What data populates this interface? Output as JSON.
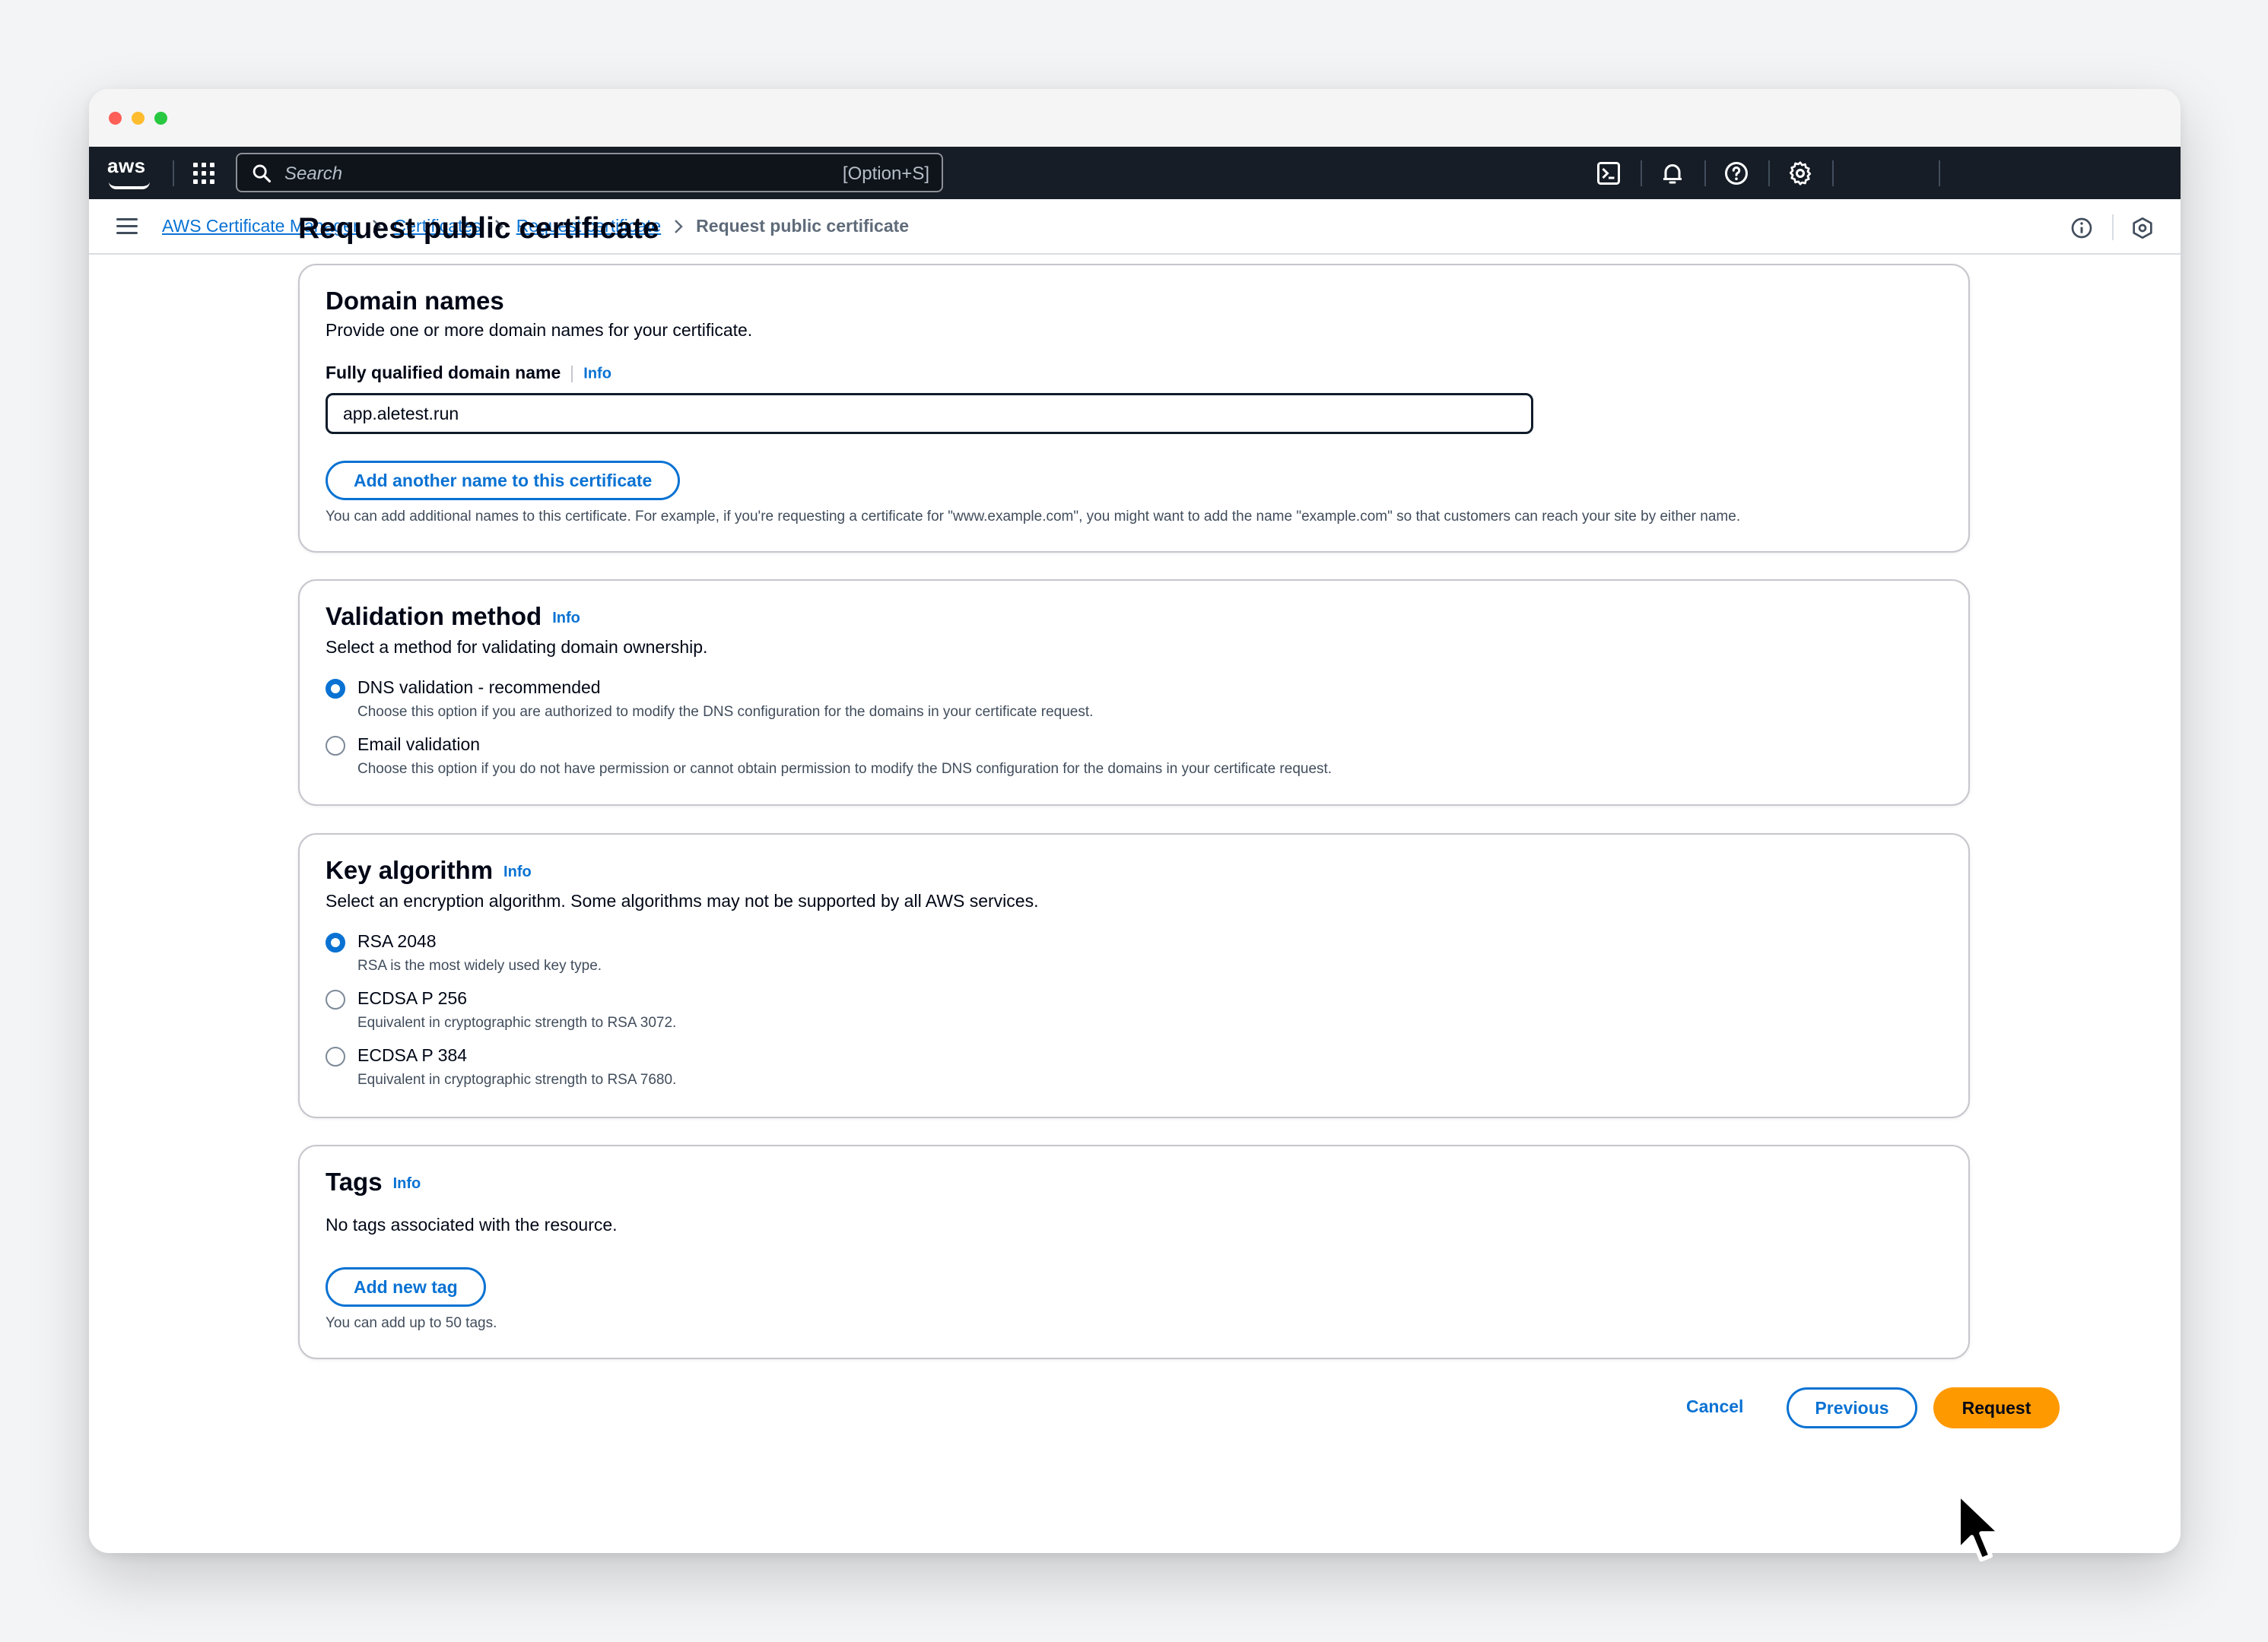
{
  "topnav": {
    "logo_text": "aws",
    "search_placeholder": "Search",
    "search_shortcut": "[Option+S]",
    "icons": [
      "grid-icon",
      "search-icon",
      "cloudshell-icon",
      "bell-icon",
      "help-icon",
      "settings-icon"
    ]
  },
  "breadcrumb": {
    "items": [
      "AWS Certificate Manager",
      "Certificates",
      "Request certificate"
    ],
    "current": "Request public certificate"
  },
  "page": {
    "title": "Request public certificate"
  },
  "domain_names": {
    "title": "Domain names",
    "description": "Provide one or more domain names for your certificate.",
    "field_label": "Fully qualified domain name",
    "info": "Info",
    "value": "app.aletest.run",
    "add_button": "Add another name to this certificate",
    "hint": "You can add additional names to this certificate. For example, if you're requesting a certificate for \"www.example.com\", you might want to add the name \"example.com\" so that customers can reach your site by either name."
  },
  "validation": {
    "title": "Validation method",
    "info": "Info",
    "description": "Select a method for validating domain ownership.",
    "options": [
      {
        "label": "DNS validation - recommended",
        "desc": "Choose this option if you are authorized to modify the DNS configuration for the domains in your certificate request.",
        "checked": true
      },
      {
        "label": "Email validation",
        "desc": "Choose this option if you do not have permission or cannot obtain permission to modify the DNS configuration for the domains in your certificate request.",
        "checked": false
      }
    ]
  },
  "key_algorithm": {
    "title": "Key algorithm",
    "info": "Info",
    "description": "Select an encryption algorithm. Some algorithms may not be supported by all AWS services.",
    "options": [
      {
        "label": "RSA 2048",
        "desc": "RSA is the most widely used key type.",
        "checked": true
      },
      {
        "label": "ECDSA P 256",
        "desc": "Equivalent in cryptographic strength to RSA 3072.",
        "checked": false
      },
      {
        "label": "ECDSA P 384",
        "desc": "Equivalent in cryptographic strength to RSA 7680.",
        "checked": false
      }
    ]
  },
  "tags": {
    "title": "Tags",
    "info": "Info",
    "description": "No tags associated with the resource.",
    "add_button": "Add new tag",
    "hint": "You can add up to 50 tags."
  },
  "actions": {
    "cancel": "Cancel",
    "previous": "Previous",
    "request": "Request"
  },
  "colors": {
    "accent": "#0972d3",
    "primary_button": "#ff9900",
    "nav_bg": "#161d26"
  }
}
